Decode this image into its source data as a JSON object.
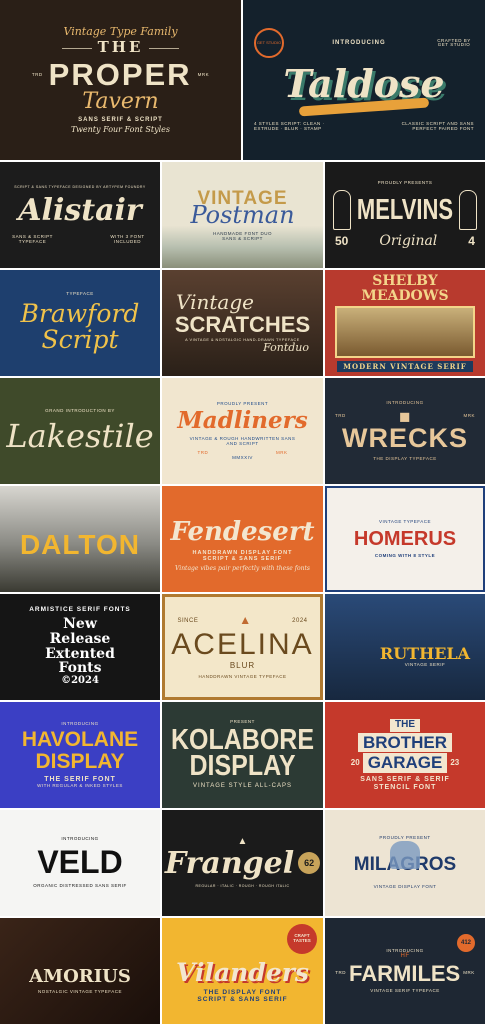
{
  "colors": {
    "dark_brown": "#2a1f17",
    "navy": "#14212c",
    "cream": "#efe3c6",
    "orange": "#e26a2c",
    "yellow": "#f2b630",
    "olive": "#3f4a2a",
    "blue_violet": "#3b3fc4",
    "red": "#c5392b"
  },
  "tiles": {
    "proper": {
      "line1": "Vintage Type Family",
      "line2": "THE",
      "side_left": "TRD",
      "side_right": "MRK",
      "line3": "PROPER",
      "line4": "Tavern",
      "line5": "SANS SERIF & SCRIPT",
      "line6": "Twenty Four Font Styles"
    },
    "taldose": {
      "badge": "GET STUDIO",
      "intro": "INTRODUCING",
      "crafted": "CRAFTED BY GET STUDIO",
      "title": "Taldose",
      "styles": "4 STYLES SCRIPT: CLEAN · EXTRUDE · BLUR · STAMP",
      "desc": "CLASSIC SCRIPT AND SANS PERFECT PAIRED FONT"
    },
    "alistair": {
      "top": "SCRIPT & SANS TYPEFACE DESIGNED BY ARTYPEM FOUNDRY",
      "title": "Alistair",
      "left": "SANS & SCRIPT TYPEFACE",
      "right": "WITH 3 FONT INCLUDED"
    },
    "postman": {
      "title": "VINTAGE",
      "script": "Postman",
      "sub": "HANDMADE FONT DUO",
      "sub2": "SANS & SCRIPT"
    },
    "melvins": {
      "top": "PROUDLY PRESENTS",
      "title": "MELVINS",
      "left": "50",
      "right": "4",
      "script": "Original"
    },
    "brawford": {
      "top": "TYPEFACE",
      "title": "Brawford",
      "title2": "Script"
    },
    "scratches": {
      "script": "Vintage",
      "title": "SCRATCHES",
      "sub": "A VINTAGE & NOSTALGIC HAND-DRAWN TYPEFACE",
      "tag": "Fontduo"
    },
    "shelby": {
      "title": "SHELBY MEADOWS",
      "sub": "MODERN VINTAGE SERIF"
    },
    "lakestile": {
      "top": "GRAND INTRODUCTION BY",
      "title": "Lakestile"
    },
    "madliners": {
      "top": "PROUDLY PRESENT",
      "title": "Madliners",
      "sub": "VINTAGE & ROUGH HANDWRITTEN SANS AND SCRIPT",
      "left": "TRD",
      "right": "MRK",
      "year": "MMXXIV"
    },
    "wrecks": {
      "intro": "INTRODUCING",
      "left": "TRD",
      "right": "MRK",
      "title": "WRECKS",
      "sub": "THE DISPLAY TYPEFACE"
    },
    "dalton": {
      "title": "DALTON"
    },
    "fendesert": {
      "title": "Fendesert",
      "sub": "HANDDRAWN DISPLAY FONT",
      "sub2": "SCRIPT & SANS SERIF",
      "tag": "Vintage vibes pair perfectly with these fonts"
    },
    "homerus": {
      "top": "VINTAGE TYPEFACE",
      "title": "HOMERUS",
      "sub": "COMING WITH 8 STYLE"
    },
    "armistice": {
      "arc": "ARMISTICE SERIF FONTS",
      "l1": "New",
      "l2": "Release",
      "l3": "Extented",
      "l4": "Fonts",
      "year": "©2024"
    },
    "acelina": {
      "since": "SINCE",
      "year": "2024",
      "title": "ACELINA",
      "blur": "BLUR",
      "sub": "HANDDRAWN VINTAGE TYPEFACE"
    },
    "ruthela": {
      "title": "RUTHELA",
      "sub": "VINTAGE SERIF"
    },
    "havolane": {
      "intro": "INTRODUCING",
      "title1": "HAVOLANE",
      "title2": "DISPLAY",
      "sub": "THE SERIF FONT",
      "sub2": "WITH REGULAR & INKED STYLES"
    },
    "kolabore": {
      "top": "PRESENT",
      "title1": "KOLABORE",
      "title2": "DISPLAY",
      "sub": "VINTAGE STYLE ALL-CAPS"
    },
    "brother": {
      "l1": "THE",
      "l2": "BROTHER",
      "l3": "GARAGE",
      "n1": "20",
      "n2": "23",
      "sub": "SANS SERIF & SERIF",
      "sub2": "STENCIL FONT"
    },
    "veld": {
      "intro": "INTRODUCING",
      "title": "VELD",
      "sub": "ORGANIC DISTRESSED SANS SERIF"
    },
    "frangel": {
      "title": "Frangel",
      "badge": "62",
      "sub": "REGULAR · ITALIC · ROUGH · ROUGH ITALIC"
    },
    "milagros": {
      "top": "PROUDLY PRESENT",
      "title": "MILAGROS",
      "sub": "VINTAGE DISPLAY FONT"
    },
    "amorius": {
      "title": "AMORIUS",
      "sub": "NOSTALGIC VINTAGE TYPEFACE"
    },
    "vilanders": {
      "badge": "CRAFT TASTES",
      "title": "Vilanders",
      "sub": "THE DISPLAY FONT",
      "sub2": "SCRIPT & SANS SERIF"
    },
    "farmiles": {
      "intro": "INTRODUCING",
      "hf": "HF",
      "left": "TRD",
      "right": "MRK",
      "title": "FARMILES",
      "badge": "412",
      "sub": "VINTAGE SERIF TYPEFACE"
    }
  }
}
